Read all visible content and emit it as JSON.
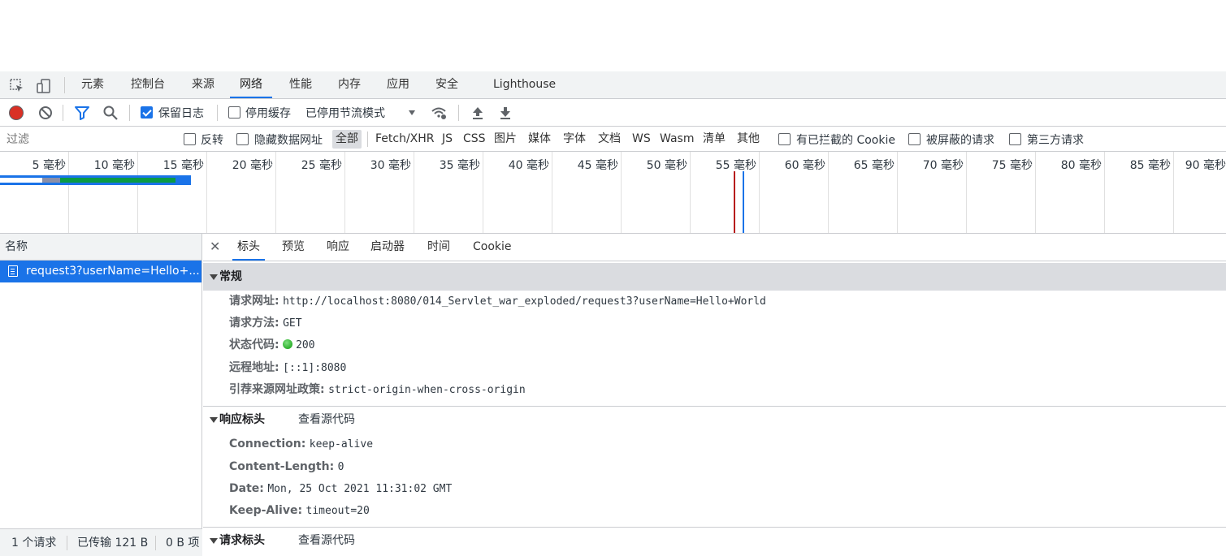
{
  "main_tabs": [
    "元素",
    "控制台",
    "来源",
    "网络",
    "性能",
    "内存",
    "应用",
    "安全",
    "Lighthouse"
  ],
  "active_main_tab": "网络",
  "toolbar": {
    "preserve_log_label": "保留日志",
    "disable_cache_label": "停用缓存",
    "throttling_value": "已停用节流模式"
  },
  "filterbar": {
    "filter_placeholder": "过滤",
    "invert_label": "反转",
    "hide_data_urls_label": "隐藏数据网址",
    "types": [
      "全部",
      "Fetch/XHR",
      "JS",
      "CSS",
      "图片",
      "媒体",
      "字体",
      "文档",
      "WS",
      "Wasm",
      "清单",
      "其他"
    ],
    "blocked_cookies_label": "有已拦截的 Cookie",
    "blocked_requests_label": "被屏蔽的请求",
    "third_party_label": "第三方请求"
  },
  "overview": {
    "ticks": [
      "5 毫秒",
      "10 毫秒",
      "15 毫秒",
      "20 毫秒",
      "25 毫秒",
      "30 毫秒",
      "35 毫秒",
      "40 毫秒",
      "45 毫秒",
      "50 毫秒",
      "55 毫秒",
      "60 毫秒",
      "65 毫秒",
      "70 毫秒",
      "75 毫秒",
      "80 毫秒",
      "85 毫秒",
      "90 毫秒"
    ],
    "colors": {
      "request_bar": "#1a73e8",
      "waiting": "#0a9a45",
      "dom_content_loaded": "#1a73e8",
      "load": "#b71c1c"
    }
  },
  "list": {
    "header": "名称",
    "rows": [
      "request3?userName=Hello+..."
    ],
    "status": {
      "requests": "1 个请求",
      "transferred": "已传输 121 B",
      "resources": "0 B 项"
    }
  },
  "detail": {
    "tabs": [
      "标头",
      "预览",
      "响应",
      "启动器",
      "时间",
      "Cookie"
    ],
    "active_tab": "标头",
    "general": {
      "title": "常规",
      "rows": [
        {
          "key": "请求网址:",
          "value": "http://localhost:8080/014_Servlet_war_exploded/request3?userName=Hello+World"
        },
        {
          "key": "请求方法:",
          "value": "GET"
        },
        {
          "key": "状态代码:",
          "value": "200"
        },
        {
          "key": "远程地址:",
          "value": "[::1]:8080"
        },
        {
          "key": "引荐来源网址政策:",
          "value": "strict-origin-when-cross-origin"
        }
      ]
    },
    "response_headers": {
      "title": "响应标头",
      "view_source": "查看源代码",
      "rows": [
        {
          "key": "Connection:",
          "value": "keep-alive"
        },
        {
          "key": "Content-Length:",
          "value": "0"
        },
        {
          "key": "Date:",
          "value": "Mon, 25 Oct 2021 11:31:02 GMT"
        },
        {
          "key": "Keep-Alive:",
          "value": "timeout=20"
        }
      ]
    },
    "request_headers": {
      "title": "请求标头",
      "view_source": "查看源代码"
    }
  }
}
